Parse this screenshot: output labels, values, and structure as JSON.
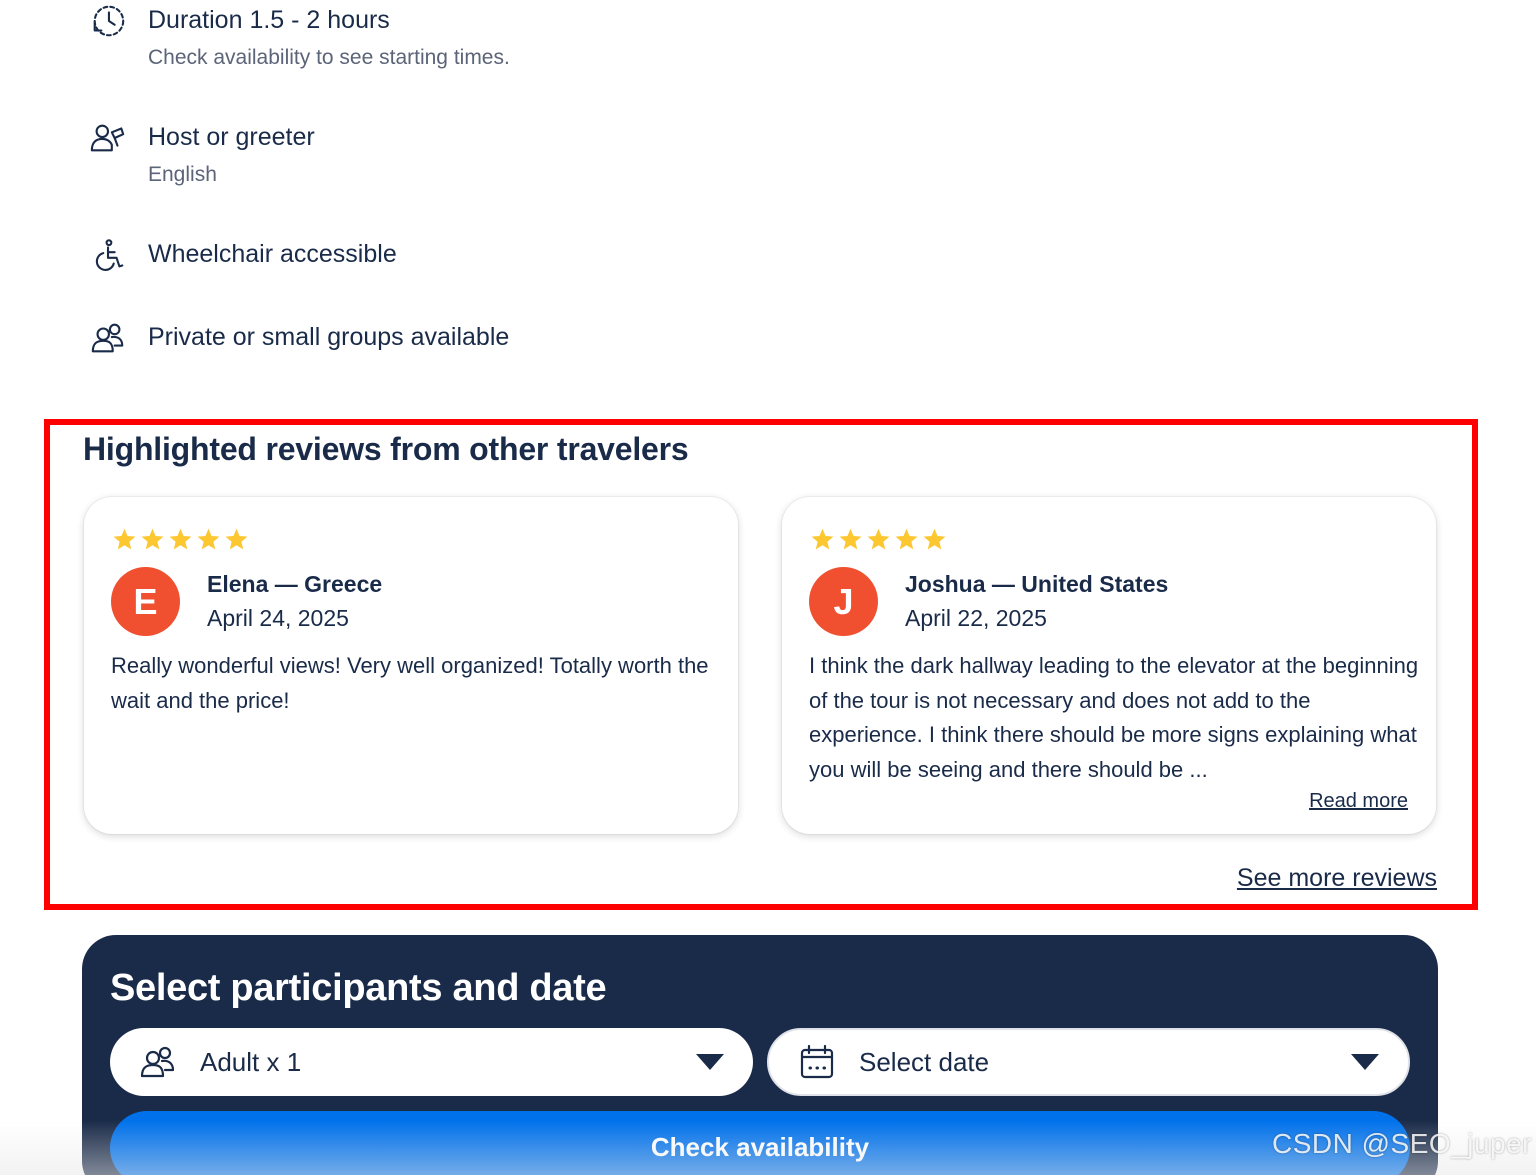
{
  "features": [
    {
      "icon": "clock-history-icon",
      "title": "Duration 1.5 - 2 hours",
      "subtitle": "Check availability to see starting times."
    },
    {
      "icon": "host-greeter-icon",
      "title": "Host or greeter",
      "subtitle": "English"
    },
    {
      "icon": "wheelchair-icon",
      "title": "Wheelchair accessible",
      "subtitle": ""
    },
    {
      "icon": "group-icon",
      "title": "Private or small groups available",
      "subtitle": ""
    }
  ],
  "reviews_section": {
    "heading": "Highlighted reviews from other travelers",
    "see_more": "See more reviews",
    "highlight_color": "#ff0000",
    "reviews": [
      {
        "rating": 5,
        "avatar_letter": "E",
        "reviewer": "Elena — Greece",
        "date": "April 24, 2025",
        "text": "Really wonderful views! Very well organized! Totally worth the wait and the price!",
        "read_more": ""
      },
      {
        "rating": 5,
        "avatar_letter": "J",
        "reviewer": "Joshua — United States",
        "date": "April 22, 2025",
        "text": "I think the dark hallway leading to the elevator at the beginning of the tour is not necessary and does not add to the experience. I think there should be more signs explaining what you will be seeing and there should be ...",
        "read_more": "Read more"
      }
    ]
  },
  "booking": {
    "title": "Select participants and date",
    "participants_label": "Adult x 1",
    "date_label": "Select date",
    "check_button": "Check availability",
    "panel_color": "#1a2b49",
    "button_color": "#0071eb"
  },
  "colors": {
    "text": "#1a2b49",
    "star": "#fdc732",
    "avatar": "#f0502f"
  },
  "watermark": "CSDN @SEO_juper"
}
